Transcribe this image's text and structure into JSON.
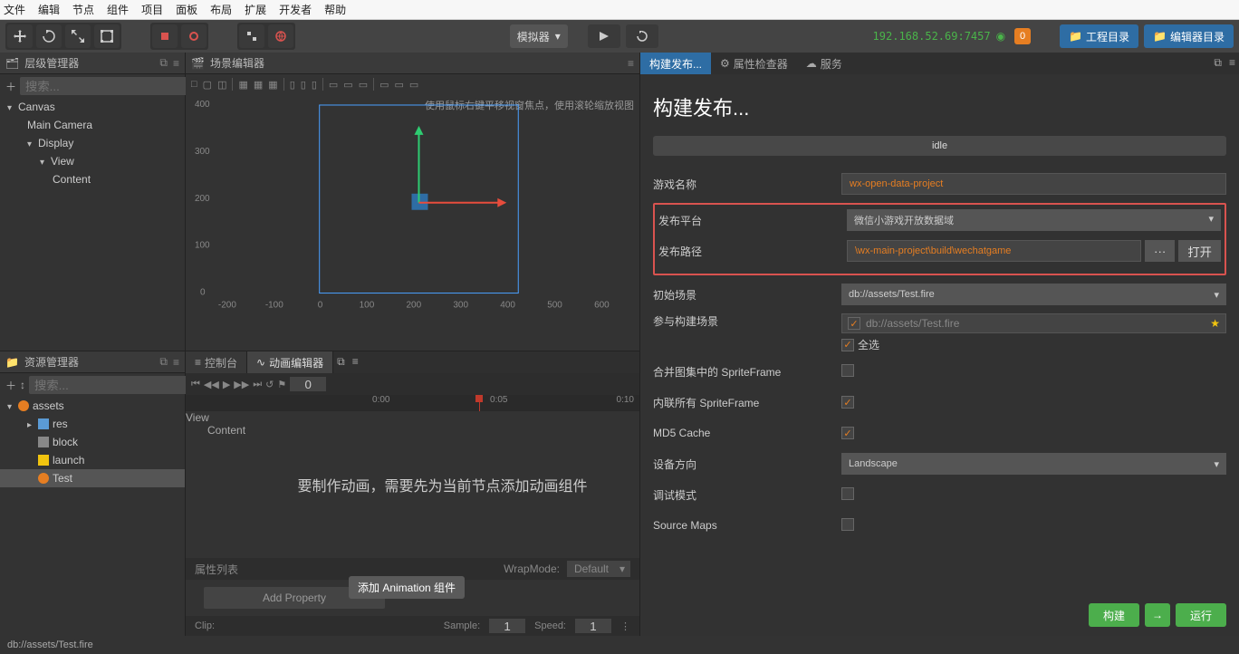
{
  "menu": [
    "文件",
    "编辑",
    "节点",
    "组件",
    "项目",
    "面板",
    "布局",
    "扩展",
    "开发者",
    "帮助"
  ],
  "toolbar": {
    "simulator": "模拟器",
    "ip": "192.168.52.69:7457",
    "notif": "0",
    "project_dir": "工程目录",
    "editor_dir": "编辑器目录"
  },
  "panels": {
    "hierarchy": "层级管理器",
    "scene": "场景编辑器",
    "assets": "资源管理器",
    "console": "控制台",
    "anim": "动画编辑器"
  },
  "search_placeholder": "搜索...",
  "hierarchy_tree": [
    "Canvas",
    "Main Camera",
    "Display",
    "View",
    "Content"
  ],
  "assets_tree": [
    "assets",
    "res",
    "block",
    "launch",
    "Test"
  ],
  "scene": {
    "hint": "使用鼠标右键平移视窗焦点，使用滚轮缩放视图",
    "ticks_y": [
      "400",
      "300",
      "200",
      "100",
      "0"
    ],
    "ticks_x": [
      "-200",
      "-100",
      "0",
      "100",
      "200",
      "300",
      "400",
      "500",
      "600"
    ]
  },
  "anim": {
    "frame": "0",
    "time_0": "0:00",
    "time_5": "0:05",
    "time_10": "0:10",
    "tree": [
      "View",
      "Content"
    ],
    "empty_msg": "要制作动画，需要先为当前节点添加动画组件",
    "proplist": "属性列表",
    "wrapmode": "WrapMode: ",
    "wrapmode_val": "Default",
    "addprop": "Add Property",
    "tooltip": "添加 Animation 组件",
    "clip": "Clip:",
    "sample": "Sample:",
    "sample_v": "1",
    "speed": "Speed:",
    "speed_v": "1"
  },
  "right_tabs": [
    "构建发布...",
    "属性检查器",
    "服务"
  ],
  "inspector": {
    "title": "构建发布...",
    "status": "idle",
    "game_name_lbl": "游戏名称",
    "game_name": "wx-open-data-project",
    "platform_lbl": "发布平台",
    "platform": "微信小游戏开放数据域",
    "path_lbl": "发布路径",
    "path": "\\wx-main-project\\build\\wechatgame",
    "path_browse": "···",
    "path_open": "打开",
    "initscene_lbl": "初始场景",
    "initscene": "db://assets/Test.fire",
    "scenes_lbl": "参与构建场景",
    "scene_item": "db://assets/Test.fire",
    "selectall": "全选",
    "merge_lbl": "合并图集中的 SpriteFrame",
    "inline_lbl": "内联所有 SpriteFrame",
    "md5_lbl": "MD5 Cache",
    "orient_lbl": "设备方向",
    "orient": "Landscape",
    "debug_lbl": "调试模式",
    "srcmap_lbl": "Source Maps",
    "build_btn": "构建",
    "arrow": "→",
    "run_btn": "运行"
  },
  "status_bar": "db://assets/Test.fire"
}
